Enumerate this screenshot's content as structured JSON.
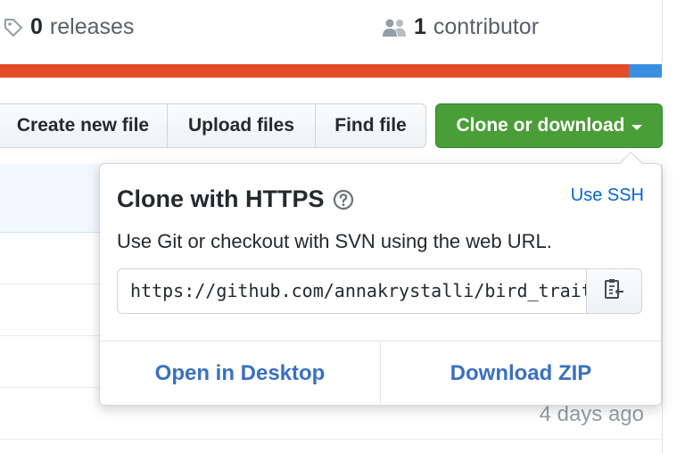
{
  "stats": {
    "releases_count": "0",
    "releases_label": "releases",
    "contributors_count": "1",
    "contributors_label": "contributor"
  },
  "language_bar": {
    "colors": [
      "#e34c26",
      "#3b8fe0"
    ],
    "shares": [
      0.95,
      0.05
    ]
  },
  "actions": {
    "create_label": "Create new file",
    "upload_label": "Upload files",
    "find_label": "Find file",
    "clone_label": "Clone or download"
  },
  "popover": {
    "title": "Clone with HTTPS",
    "use_ssh": "Use SSH",
    "description": "Use Git or checkout with SVN using the web URL.",
    "url": "https://github.com/annakrystalli/bird_trait_networks.git",
    "open_desktop": "Open in Desktop",
    "download_zip": "Download ZIP"
  },
  "file_list": {
    "age": "4 days ago"
  },
  "icons": {
    "tag": "tag-icon",
    "people": "people-icon",
    "help": "question-icon",
    "clipboard": "clipboard-icon"
  },
  "colors": {
    "clone_button": "#4a9e37",
    "link": "#0366d6"
  }
}
